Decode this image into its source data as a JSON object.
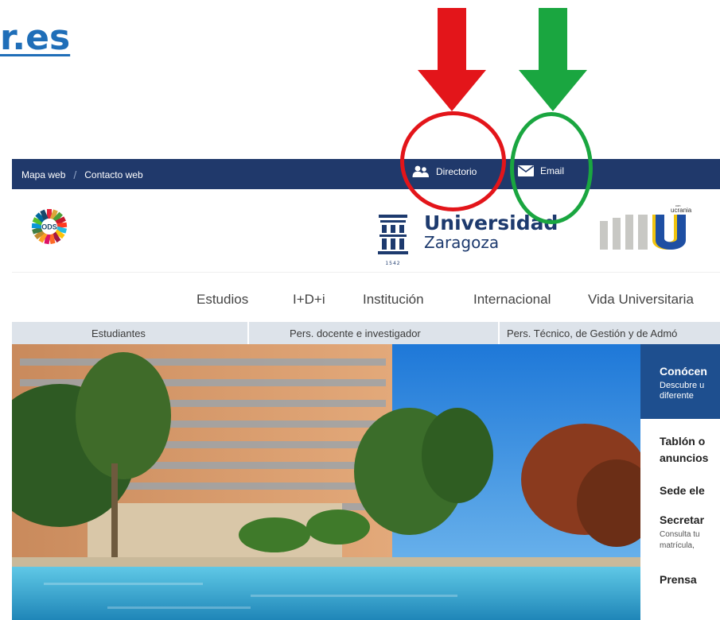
{
  "annotation": {
    "domain_fragment": "r.es",
    "arrow_colors": {
      "red": "#e3151a",
      "green": "#1aa640"
    }
  },
  "utility_bar": {
    "mapa_web": "Mapa web",
    "separator": "/",
    "contacto_web": "Contacto web",
    "directorio": "Directorio",
    "email": "Email",
    "background": "#20396b"
  },
  "header": {
    "ods_badge": "ODS",
    "uni_name": "Universidad",
    "uni_city": "Zaragoza",
    "uni_year": "1542",
    "ucrania_tag": "ucrania",
    "ucrania_con": "con"
  },
  "main_nav": {
    "items": [
      "Estudios",
      "I+D+i",
      "Institución",
      "Internacional",
      "Vida Universitaria"
    ]
  },
  "audience_bar": {
    "items": [
      "Estudiantes",
      "Pers. docente e investigador",
      "Pers. Técnico, de Gestión y de Admó"
    ]
  },
  "side_panel": {
    "title": "Conócen",
    "desc_line1": "Descubre u",
    "desc_line2": "diferente",
    "tablon_line1": "Tablón o",
    "tablon_line2": "anuncios",
    "sede": "Sede ele",
    "secretaria": "Secretar",
    "secretaria_sub1": "Consulta tu",
    "secretaria_sub2": "matrícula,",
    "prensa": "Prensa"
  }
}
